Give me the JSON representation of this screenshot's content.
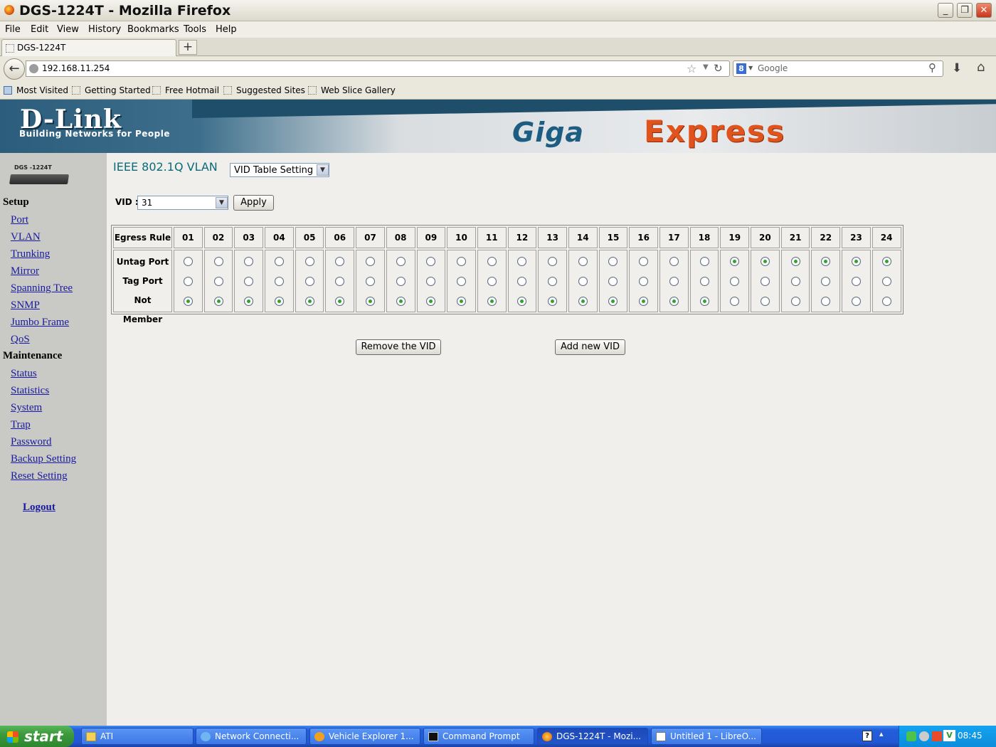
{
  "window": {
    "title": "DGS-1224T - Mozilla Firefox"
  },
  "menubar": [
    "File",
    "Edit",
    "View",
    "History",
    "Bookmarks",
    "Tools",
    "Help"
  ],
  "tab": {
    "label": "DGS-1224T",
    "new_tab": "+"
  },
  "nav": {
    "url": "192.168.11.254",
    "search_placeholder": "Google"
  },
  "bookmarks": [
    "Most Visited",
    "Getting Started",
    "Free Hotmail",
    "Suggested Sites",
    "Web Slice Gallery"
  ],
  "banner": {
    "brand": "D-Link",
    "tagline": "Building Networks for People",
    "giga": "Giga",
    "express": "Express"
  },
  "device_label": "DGS -1224T",
  "sidebar": {
    "setup_heading": "Setup",
    "setup_links": [
      "Port",
      "VLAN",
      "Trunking",
      "Mirror",
      "Spanning Tree",
      "SNMP",
      "Jumbo Frame",
      "QoS"
    ],
    "maintenance_heading": "Maintenance",
    "maintenance_links": [
      "Status",
      "Statistics",
      "System",
      "Trap",
      "Password",
      "Backup Setting",
      "Reset Setting"
    ],
    "logout": "Logout"
  },
  "content": {
    "title": "IEEE 802.1Q VLAN",
    "mode_select": "VID Table Setting",
    "vid_label": "VID :",
    "vid_value": "31",
    "apply": "Apply",
    "remove_button": "Remove the VID",
    "add_button": "Add new VID"
  },
  "vlan_table": {
    "header": "Egress Rule",
    "rules": [
      "Untag Port",
      "Tag Port",
      "Not Member"
    ],
    "ports": [
      "01",
      "02",
      "03",
      "04",
      "05",
      "06",
      "07",
      "08",
      "09",
      "10",
      "11",
      "12",
      "13",
      "14",
      "15",
      "16",
      "17",
      "18",
      "19",
      "20",
      "21",
      "22",
      "23",
      "24"
    ],
    "selected": [
      "Not Member",
      "Not Member",
      "Not Member",
      "Not Member",
      "Not Member",
      "Not Member",
      "Not Member",
      "Not Member",
      "Not Member",
      "Not Member",
      "Not Member",
      "Not Member",
      "Not Member",
      "Not Member",
      "Not Member",
      "Not Member",
      "Not Member",
      "Not Member",
      "Untag Port",
      "Untag Port",
      "Untag Port",
      "Untag Port",
      "Untag Port",
      "Untag Port"
    ]
  },
  "taskbar": {
    "start": "start",
    "tasks": [
      "ATI",
      "Network Connecti...",
      "Vehicle Explorer 1...",
      "Command Prompt",
      "DGS-1224T - Mozi...",
      "Untitled 1 - LibreO..."
    ],
    "active_index": 4,
    "clock": "08:45"
  }
}
